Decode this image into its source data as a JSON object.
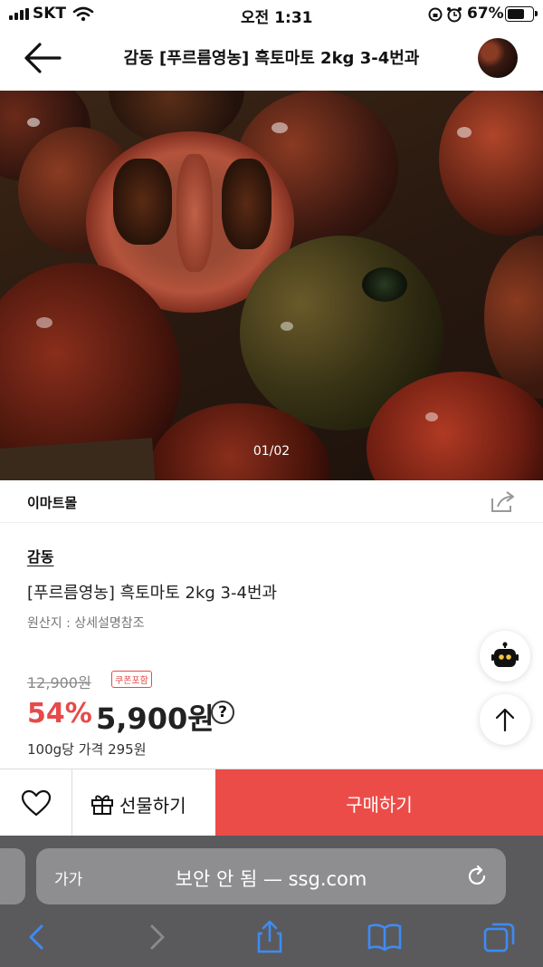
{
  "status": {
    "carrier": "SKT",
    "time": "오전 1:31",
    "battery": "67%"
  },
  "header": {
    "title": "감동 [푸르름영농] 흑토마토 2kg 3-4번과"
  },
  "hero": {
    "counter": "01/02"
  },
  "store": {
    "name": "이마트몰"
  },
  "product": {
    "brand": "감동",
    "name": "[푸르름영농] 흑토마토 2kg 3-4번과",
    "origin": "원산지 : 상세설명참조",
    "original_price": "12,900원",
    "coupon_badge": "쿠폰포함",
    "discount": "54%",
    "price": "5,900원",
    "unit_price": "100g당 가격 295원"
  },
  "actions": {
    "gift_label": "선물하기",
    "buy_label": "구매하기"
  },
  "browser": {
    "text_size": "가가",
    "url": "보안 안 됨 — ssg.com"
  },
  "colors": {
    "accent": "#ec4c48",
    "discount": "#e64a4a",
    "safari_bg": "#5a5a5c"
  },
  "icons": [
    "back-arrow-icon",
    "share-icon",
    "chatbot-icon",
    "arrow-up-icon",
    "heart-icon",
    "gift-icon",
    "reload-icon",
    "chevron-left-icon",
    "chevron-right-icon",
    "share-upload-icon",
    "bookmarks-icon",
    "tabs-icon"
  ]
}
